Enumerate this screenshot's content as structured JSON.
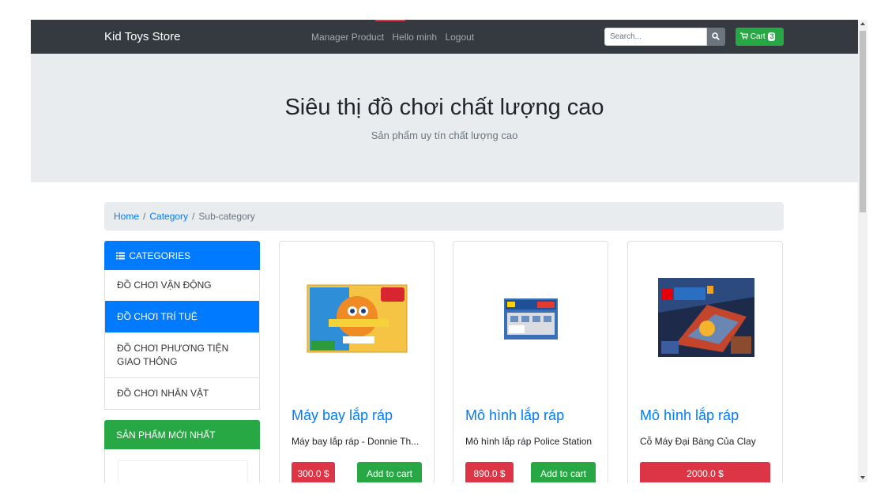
{
  "navbar": {
    "brand": "Kid Toys Store",
    "links": [
      "Manager Product",
      "Hello minh",
      "Logout"
    ],
    "search_placeholder": "Search...",
    "cart_label": "Cart",
    "cart_count": "3"
  },
  "jumbotron": {
    "title": "Siêu thị đồ chơi chất lượng cao",
    "subtitle": "Sản phẩm uy tín chất lượng cao"
  },
  "breadcrumb": {
    "home": "Home",
    "category": "Category",
    "current": "Sub-category",
    "separator": "/"
  },
  "sidebar": {
    "categories_title": "CATEGORIES",
    "categories": [
      {
        "label": "ĐỒ CHƠI VẬN ĐỘNG",
        "active": false
      },
      {
        "label": "ĐỒ CHƠI TRÍ TUỆ",
        "active": true
      },
      {
        "label": "ĐỒ CHƠI PHƯƠNG TIỆN GIAO THÔNG",
        "active": false
      },
      {
        "label": "ĐỒ CHƠI NHÂN VẬT",
        "active": false
      }
    ],
    "new_products_title": "SẢN PHẨM MỚI NHẤT"
  },
  "products": [
    {
      "title": "Máy bay lắp ráp",
      "description": "Máy bay lắp ráp - Donnie Th...",
      "price": "300.0 $",
      "add_label": "Add to cart"
    },
    {
      "title": "Mô hình lắp ráp",
      "description": "Mô hình lắp ráp Police Station",
      "price": "890.0 $",
      "add_label": "Add to cart"
    },
    {
      "title": "Mô hình lắp ráp",
      "description": "Cỗ Máy Đại Bàng Của Clay",
      "price": "2000.0 $"
    }
  ],
  "colors": {
    "navbar": "#343a40",
    "primary": "#007bff",
    "success": "#28a745",
    "danger": "#dc3545",
    "jumbotron": "#e9ecef"
  }
}
